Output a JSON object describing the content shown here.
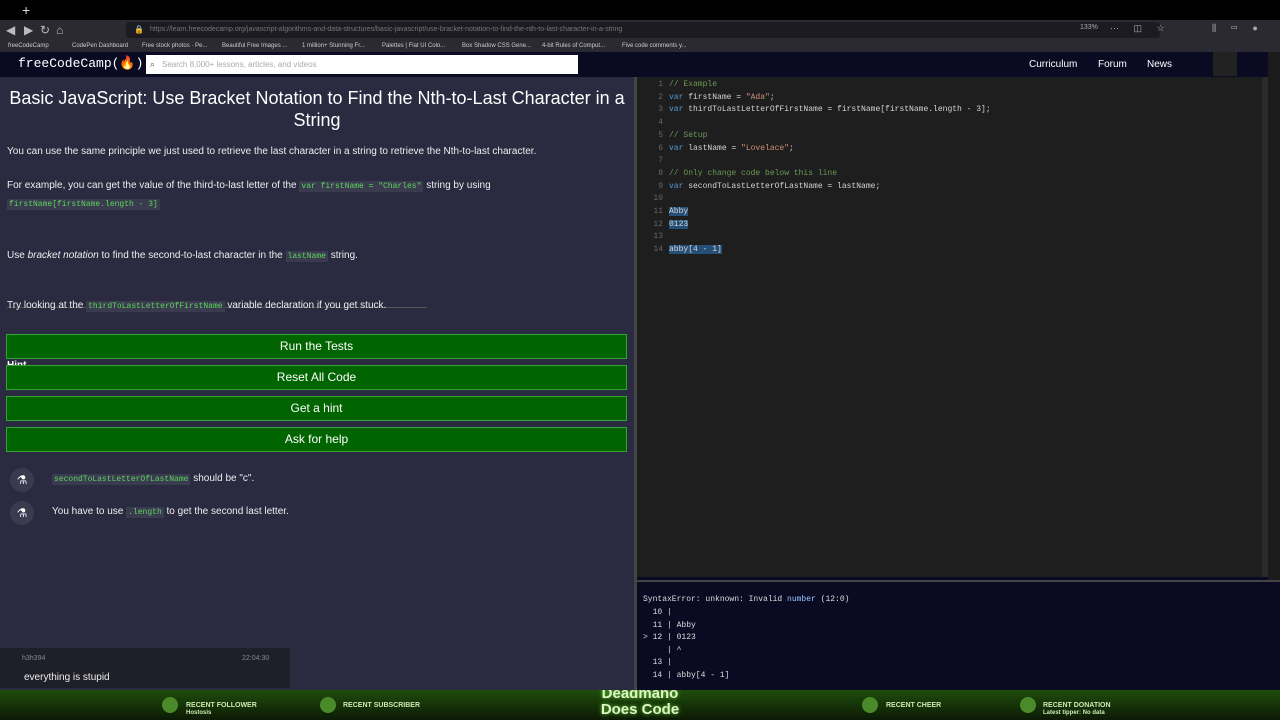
{
  "browser": {
    "new_tab_label": "+",
    "url": "https://learn.freecodecamp.org/javascript-algorithms-and-data-structures/basic-javascript/use-bracket-notation-to-find-the-nth-to-last-character-in-a-string",
    "zoom": "133%",
    "bookmarks": [
      "freeCodeCamp",
      "CodePen Dashboard",
      "Free stock photos · Pe...",
      "Beautiful Free Images ...",
      "1 million+ Stunning Fr...",
      "Palettes | Flat UI Colo...",
      "Box Shadow CSS Gene...",
      "4-bit Rules of Comput...",
      "Five code comments y..."
    ]
  },
  "fcc": {
    "logo": "freeCodeCamp(🔥)",
    "search_placeholder": "Search 8,000+ lessons, articles, and videos",
    "links": [
      "Curriculum",
      "Forum",
      "News"
    ]
  },
  "lesson": {
    "title": "Basic JavaScript: Use Bracket Notation to Find the Nth-to-Last Character in a String",
    "p1": "You can use the same principle we just used to retrieve the last character in a string to retrieve the Nth-to-last character.",
    "p2_before": "For example, you can get the value of the third-to-last letter of the ",
    "p2_code1": "var firstName = \"Charles\"",
    "p2_after": " string by using",
    "p2_code2": "firstName[firstName.length - 3]",
    "p3_before": "Use ",
    "p3_em": "bracket notation",
    "p3_mid": " to find the second-to-last character in the ",
    "p3_code": "lastName",
    "p3_after": " string.",
    "hint_title": "Hint",
    "hint_before": "Try looking at the ",
    "hint_code": "thirdToLastLetterOfFirstName",
    "hint_after": " variable declaration if you get stuck."
  },
  "buttons": {
    "run": "Run the Tests",
    "reset": "Reset All Code",
    "hint": "Get a hint",
    "help": "Ask for help"
  },
  "tests": [
    {
      "code": "secondToLastLetterOfLastName",
      "text": " should be \"c\"."
    },
    {
      "pre": "You have to use ",
      "code": ".length",
      "text": " to get the second last letter."
    }
  ],
  "editor": {
    "lines": [
      {
        "n": "1",
        "parts": [
          {
            "t": "// Example",
            "c": "cm"
          }
        ]
      },
      {
        "n": "2",
        "parts": [
          {
            "t": "var",
            "c": "kw"
          },
          {
            "t": " firstName = ",
            "c": ""
          },
          {
            "t": "\"Ada\"",
            "c": "str"
          },
          {
            "t": ";",
            "c": ""
          }
        ]
      },
      {
        "n": "3",
        "parts": [
          {
            "t": "var",
            "c": "kw"
          },
          {
            "t": " thirdToLastLetterOfFirstName = firstName[firstName.length - 3];",
            "c": ""
          }
        ]
      },
      {
        "n": "4",
        "parts": []
      },
      {
        "n": "5",
        "parts": [
          {
            "t": "// Setup",
            "c": "cm"
          }
        ]
      },
      {
        "n": "6",
        "parts": [
          {
            "t": "var",
            "c": "kw"
          },
          {
            "t": " lastName = ",
            "c": ""
          },
          {
            "t": "\"Lovelace\"",
            "c": "str"
          },
          {
            "t": ";",
            "c": ""
          }
        ]
      },
      {
        "n": "7",
        "parts": []
      },
      {
        "n": "8",
        "parts": [
          {
            "t": "// Only change code below this line",
            "c": "cm"
          }
        ]
      },
      {
        "n": "9",
        "parts": [
          {
            "t": "var",
            "c": "kw"
          },
          {
            "t": " secondToLastLetterOfLastName = lastName;",
            "c": ""
          }
        ]
      },
      {
        "n": "10",
        "parts": []
      },
      {
        "n": "11",
        "parts": [
          {
            "t": "Abby",
            "c": "sel"
          }
        ]
      },
      {
        "n": "12",
        "parts": [
          {
            "t": "0123",
            "c": "sel"
          }
        ]
      },
      {
        "n": "13",
        "parts": []
      },
      {
        "n": "14",
        "parts": [
          {
            "t": "abby[4 - 1]",
            "c": "sel"
          }
        ]
      }
    ]
  },
  "console": {
    "error_prefix": "SyntaxError: unknown: Invalid ",
    "error_word": "number",
    "error_suffix": " (12:0)",
    "lines": [
      "  10 |",
      "  11 | Abby",
      "> 12 | 0123",
      "     | ^",
      "  13 |",
      "  14 | abby[4 - 1]"
    ]
  },
  "chat": {
    "user": "h3h394",
    "time": "22:04:30",
    "message": "everything is stupid"
  },
  "footer": {
    "title_line1": "Deadmano",
    "title_line2": "Does Code",
    "follower_label": "RECENT FOLLOWER",
    "follower_name": "Hostosis",
    "subscriber_label": "RECENT SUBSCRIBER",
    "cheer_label": "RECENT CHEER",
    "donation_label": "RECENT DONATION",
    "donation_sub": "Latest tipper: No data"
  }
}
